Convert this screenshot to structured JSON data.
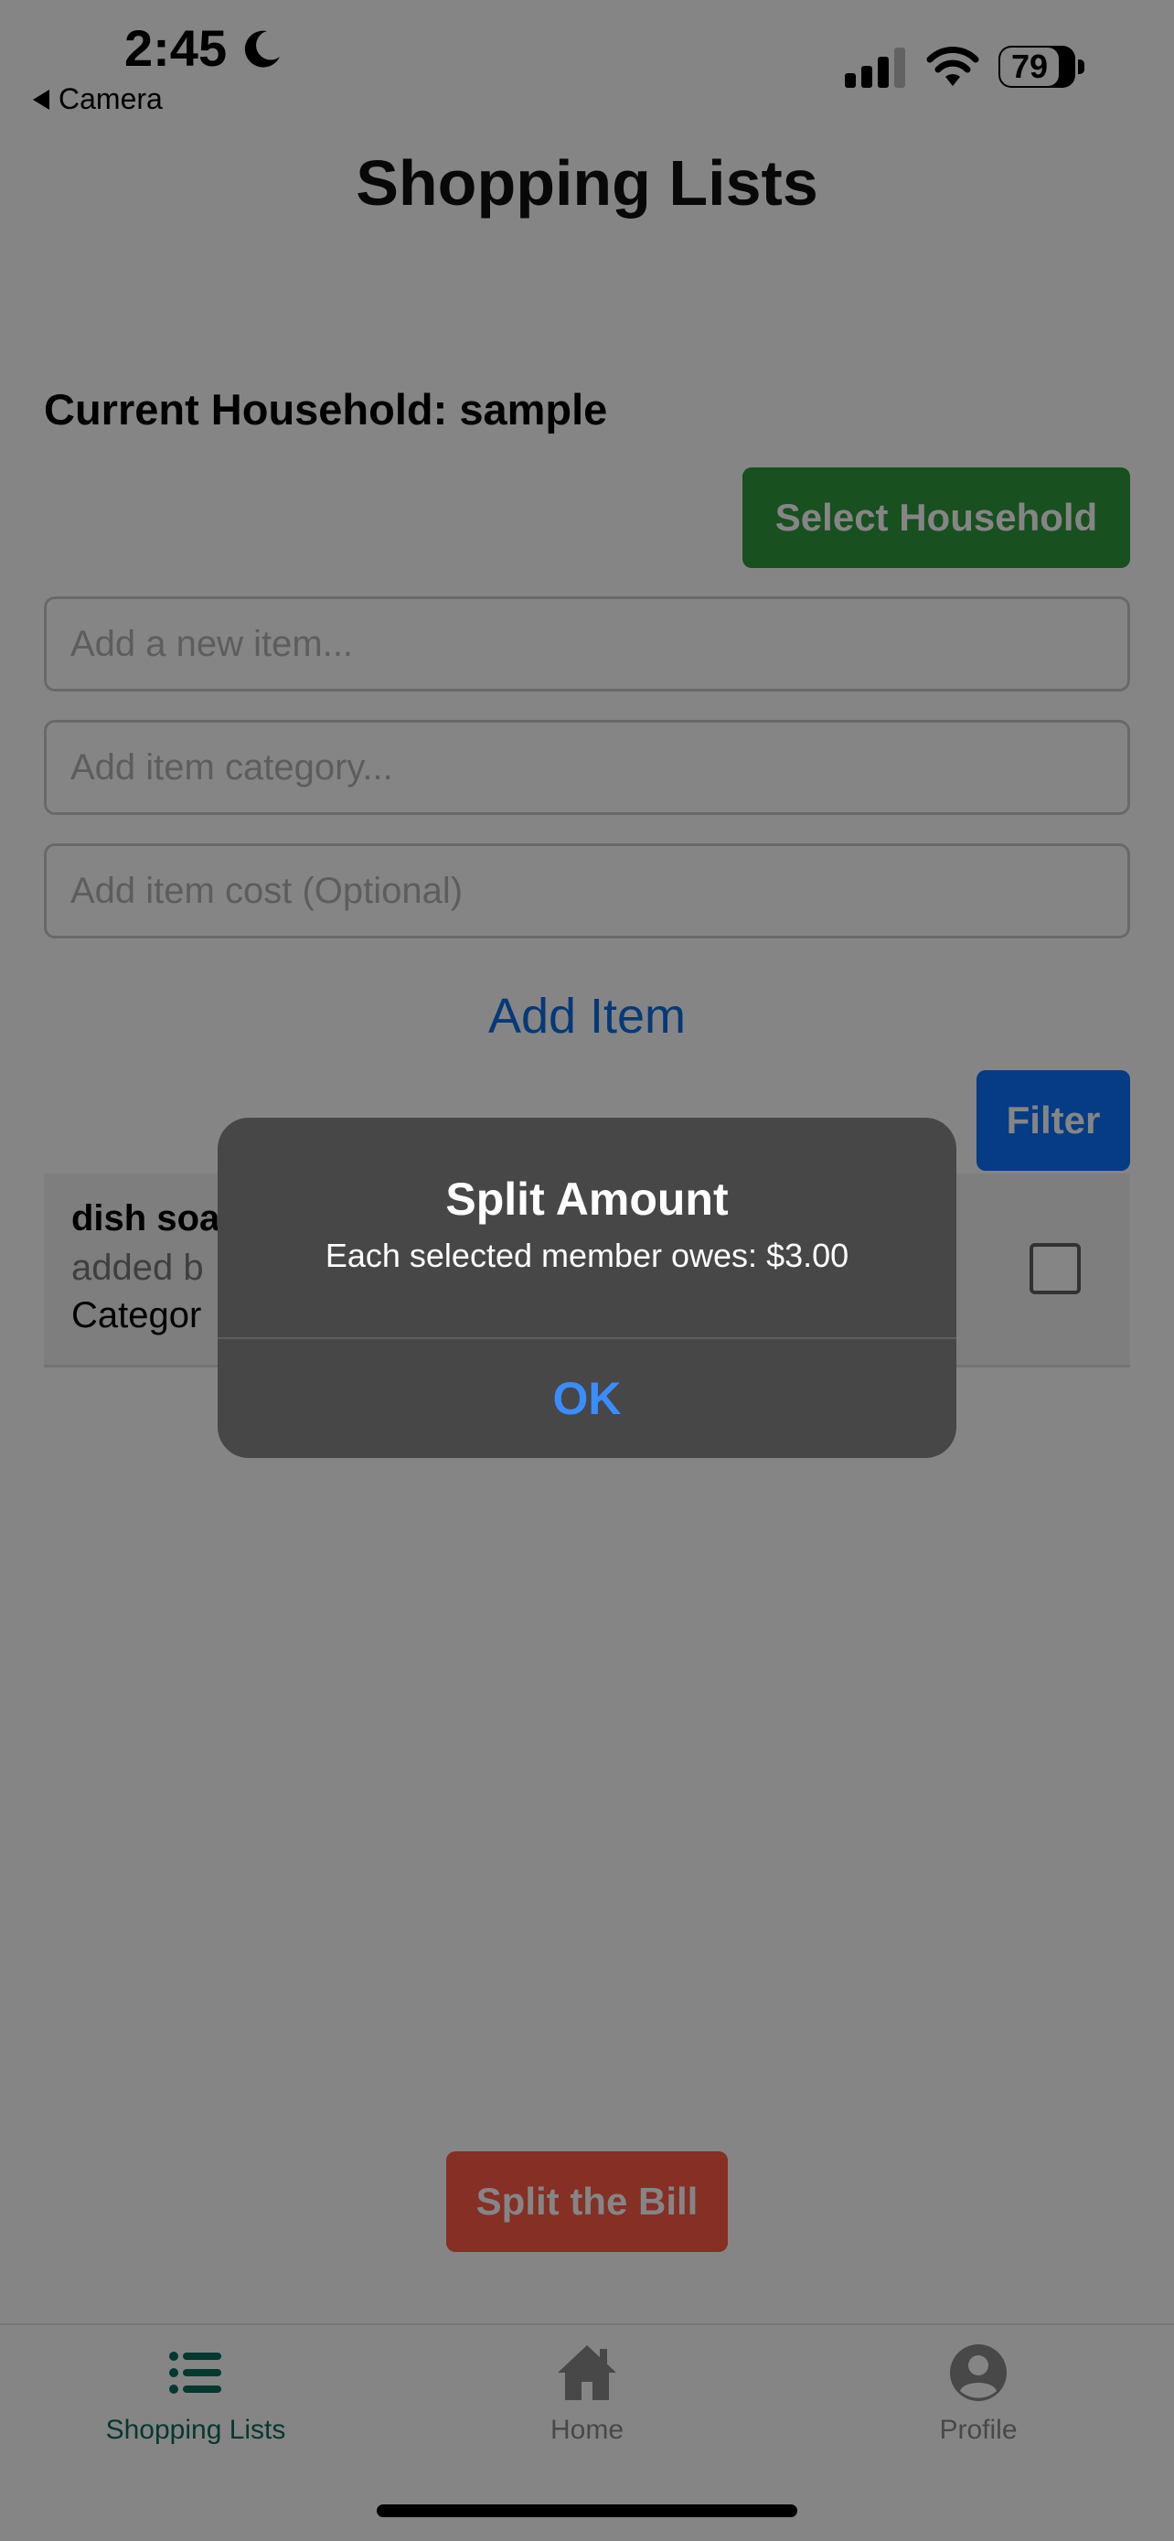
{
  "status_bar": {
    "time": "2:45",
    "back_label": "Camera",
    "battery": "79"
  },
  "header": {
    "title": "Shopping Lists"
  },
  "household": {
    "current_label": "Current Household: sample",
    "select_button": "Select Household"
  },
  "form": {
    "item_placeholder": "Add a new item...",
    "category_placeholder": "Add item category...",
    "cost_placeholder": "Add item cost (Optional)",
    "add_button": "Add Item"
  },
  "filter_button": "Filter",
  "list": {
    "items": [
      {
        "name": "dish soa",
        "added_by": "added b",
        "category": "Categor",
        "checked": false
      }
    ]
  },
  "split_button": "Split the Bill",
  "tabs": [
    {
      "label": "Shopping Lists",
      "icon": "list-icon",
      "active": true
    },
    {
      "label": "Home",
      "icon": "home-icon",
      "active": false
    },
    {
      "label": "Profile",
      "icon": "person-circle-icon",
      "active": false
    }
  ],
  "colors": {
    "green": "#2f9a3f",
    "blue": "#0a73ff",
    "red": "#ff5a47",
    "tab_active": "#0b6b5e",
    "tab_inactive": "#8a8a8a"
  },
  "alert": {
    "title": "Split Amount",
    "message": "Each selected member owes: $3.00",
    "ok": "OK"
  }
}
